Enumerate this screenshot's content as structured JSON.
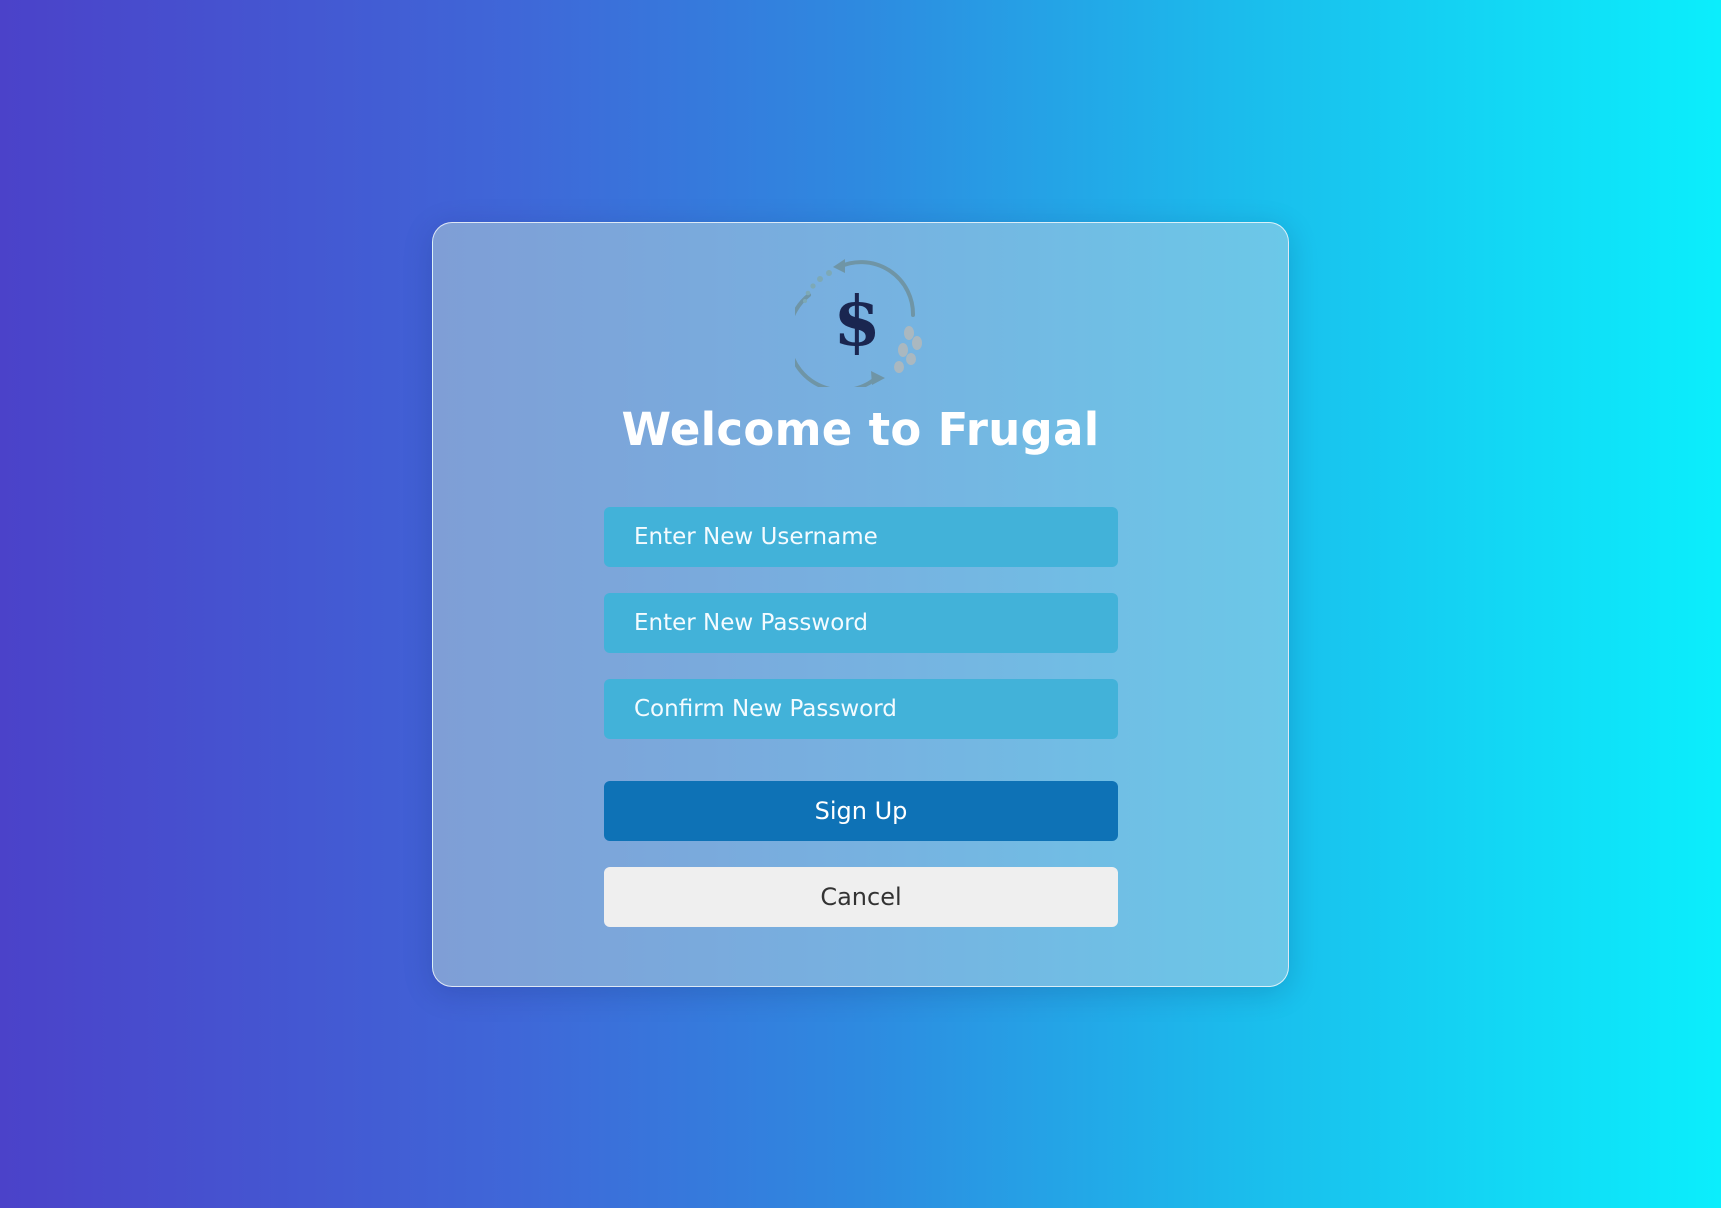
{
  "colors": {
    "background_start": "#4b42c9",
    "background_end": "#0beefc",
    "field_bg": "#42b2d9",
    "primary_button": "#0e72b6",
    "secondary_button": "#efefef"
  },
  "logo": {
    "icon": "dollar-recycle-logo",
    "symbol": "$"
  },
  "title": "Welcome to Frugal",
  "form": {
    "username_placeholder": "Enter New Username",
    "password_placeholder": "Enter New Password",
    "confirm_placeholder": "Confirm New Password",
    "signup_label": "Sign Up",
    "cancel_label": "Cancel"
  }
}
